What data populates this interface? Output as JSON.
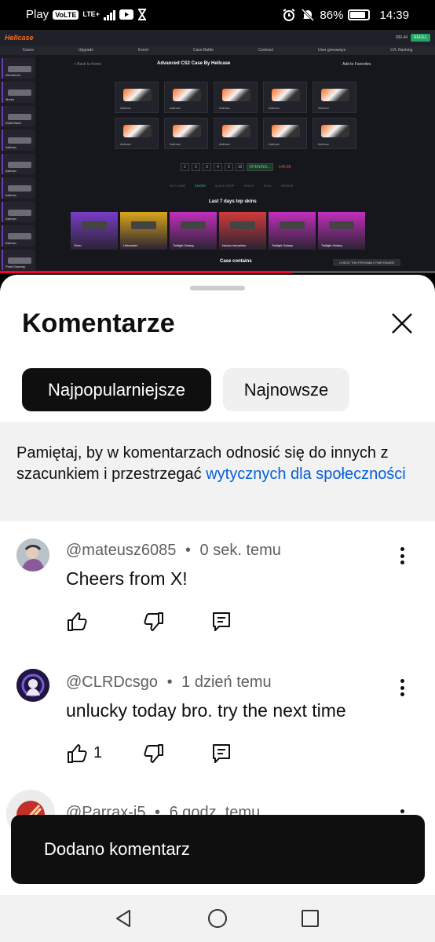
{
  "status_bar": {
    "carrier": "Play",
    "volte": "VoLTE",
    "network": "LTE+",
    "battery": "86%",
    "battery_level": 0.86,
    "time": "14:39"
  },
  "video": {
    "site_name": "Hellcase",
    "balance": "200.44",
    "refill": "REFILL",
    "nav": [
      "Cases",
      "Upgrade",
      "Event",
      "Case Battle",
      "Contract",
      "User giveaways",
      "LVL Ranking"
    ],
    "back_label": "< Back to home",
    "title": "Advanced CS2 Case By Hellcase",
    "favorites": "Add to Favorites",
    "case_label": "Asiimov",
    "pages": [
      "1",
      "2",
      "3",
      "4",
      "5",
      "10"
    ],
    "open_label": "OPENING...",
    "price": "-140.95",
    "options": {
      "buy_case": "BUY CASE",
      "quick_stop": "QUICK STOP",
      "roll": "ROLL",
      "repeat": "REPEAT",
      "enter": "ENTER",
      "space": "SPACE"
    },
    "top_skins_title": "Last 7 days top skins",
    "top_skins": [
      {
        "name": "Orion",
        "color": "#7a3cc7"
      },
      {
        "name": "Ultraviolet",
        "color": "#d9a51b"
      },
      {
        "name": "Twilight Galaxy",
        "color": "#c22fbd"
      },
      {
        "name": "Nocha Industries",
        "color": "#d23a3a"
      },
      {
        "name": "Twilight Galaxy",
        "color": "#c22fbd"
      },
      {
        "name": "Twilight Galaxy",
        "color": "#c22fbd"
      }
    ],
    "case_contains": "Case contains",
    "provably_fair": "CHECK THE PROVABLY FAIR RANGE",
    "sidebar_items": [
      "Ouroboros",
      "Morris",
      "Dolla Blaze",
      "Asiimov",
      "Asiimov",
      "Asiimov",
      "Asiimov",
      "Asiimov",
      "Point Disarray"
    ],
    "progress": 0.67
  },
  "comments_panel": {
    "title": "Komentarze",
    "chips": {
      "top": "Najpopularniejsze",
      "newest": "Najnowsze"
    },
    "notice": {
      "text": "Pamiętaj, by w komentarzach odnosić się do innych z szacunkiem i przestrzegać ",
      "link": "wytycznych dla społeczności"
    },
    "comments": [
      {
        "author": "@mateusz6085",
        "separator": "•",
        "time": "0 sek. temu",
        "text": "Cheers from X!",
        "likes": ""
      },
      {
        "author": "@CLRDcsgo",
        "separator": "•",
        "time": "1 dzień temu",
        "text": "unlucky today bro. try the next time",
        "likes": "1"
      },
      {
        "author": "@Parrax-i5",
        "separator": "•",
        "time": "6 godz. temu",
        "text": "",
        "likes": ""
      }
    ]
  },
  "toast": {
    "text": "Dodano komentarz"
  },
  "icons": {
    "close": "close-icon",
    "like": "thumb-up-icon",
    "dislike": "thumb-down-icon",
    "reply": "comment-icon",
    "more": "more-vert-icon",
    "nav_back": "back-triangle-icon",
    "nav_home": "home-circle-icon",
    "nav_recents": "recents-square-icon"
  }
}
